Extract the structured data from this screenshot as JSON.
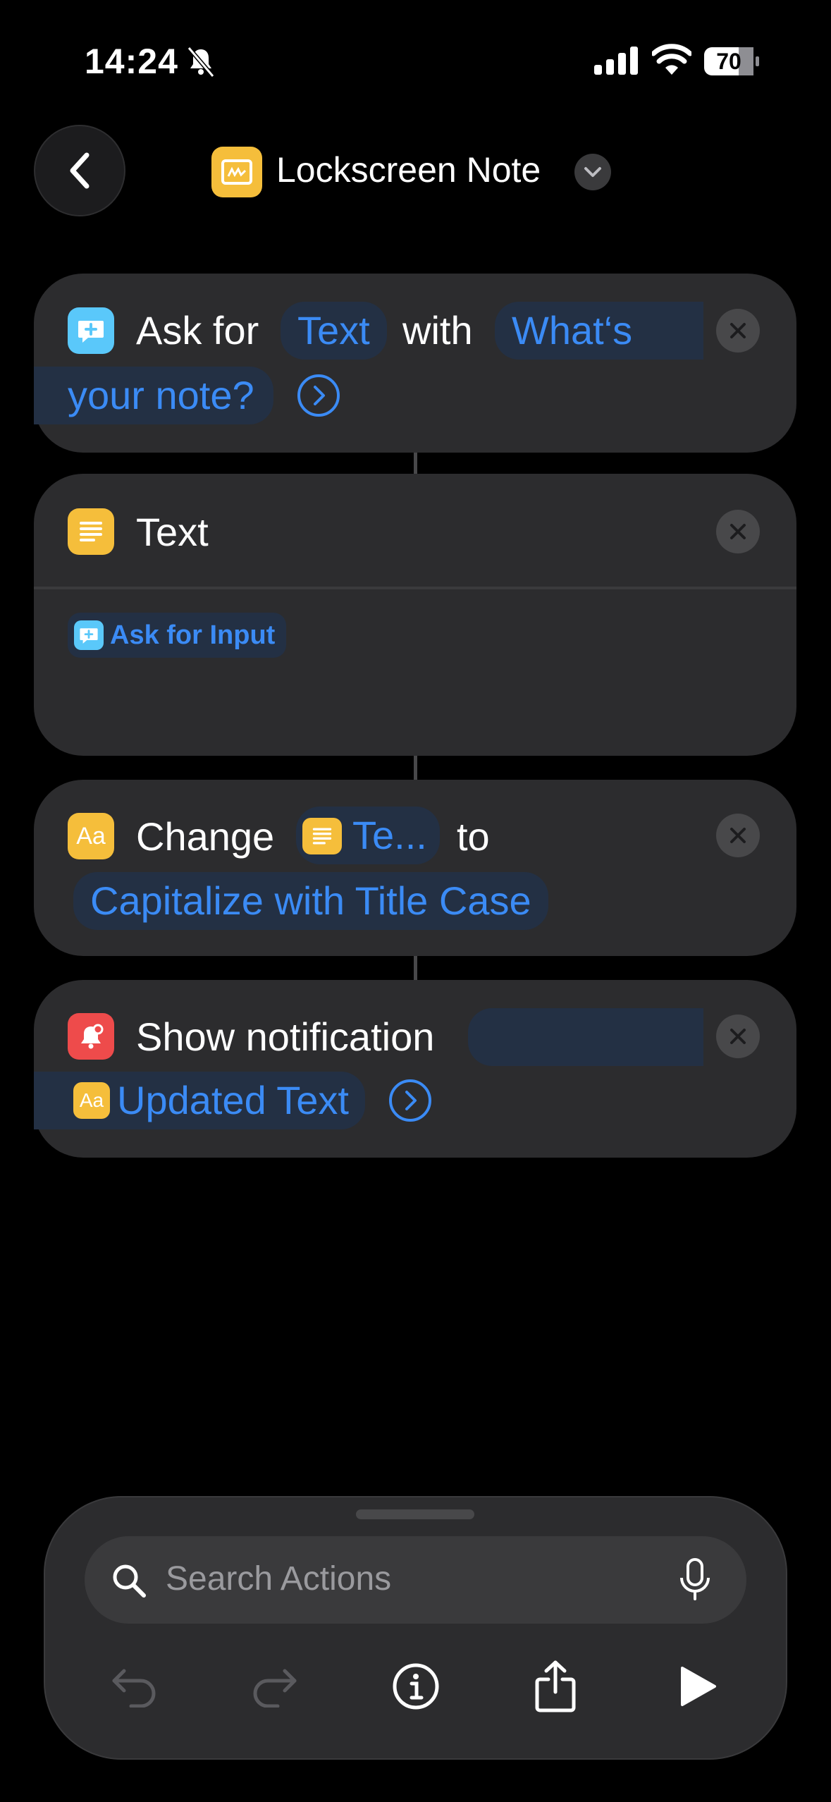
{
  "status_bar": {
    "time": "14:24",
    "battery": "70"
  },
  "header": {
    "title": "Lockscreen Note"
  },
  "actions": {
    "ask": {
      "label1": "Ask for",
      "token1": "Text",
      "label2": "with",
      "prompt_line1": "What‘s",
      "prompt_line2": "your note?"
    },
    "text": {
      "label": "Text",
      "variable": "Ask for Input"
    },
    "change": {
      "label1": "Change",
      "token": "Te...",
      "label2": "to",
      "option": "Capitalize with Title Case"
    },
    "notify": {
      "label": "Show notification",
      "variable": "Updated Text"
    }
  },
  "toolbar": {
    "search_placeholder": "Search Actions"
  },
  "colors": {
    "accent": "#3b8bf5",
    "yellow": "#f5be3b",
    "cyan": "#5ac8fa",
    "red": "#ee4b4b",
    "card": "#2c2c2e"
  }
}
